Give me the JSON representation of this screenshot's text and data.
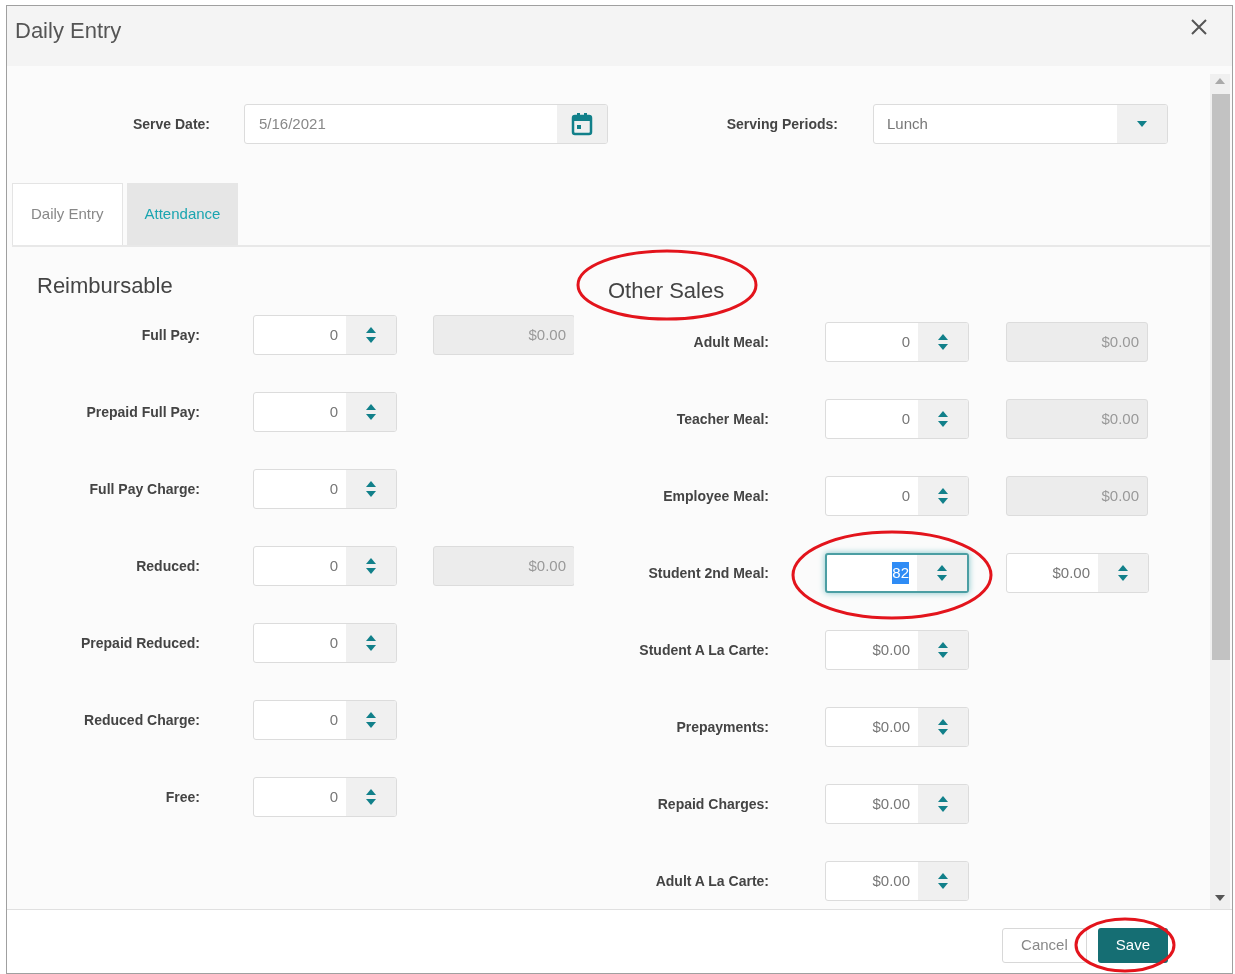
{
  "window": {
    "title": "Daily Entry"
  },
  "serve_date": {
    "label": "Serve Date:",
    "value": "5/16/2021"
  },
  "serving_periods": {
    "label": "Serving Periods:",
    "value": "Lunch"
  },
  "tabs": [
    {
      "label": "Daily Entry",
      "selected": true
    },
    {
      "label": "Attendance",
      "selected": false
    }
  ],
  "reimbursable": {
    "title": "Reimbursable",
    "rows": [
      {
        "label": "Full Pay:",
        "value": "0",
        "focused": false,
        "amount": {
          "kind": "readonly",
          "value": "$0.00"
        }
      },
      {
        "label": "Prepaid Full Pay:",
        "value": "0",
        "focused": false
      },
      {
        "label": "Full Pay Charge:",
        "value": "0",
        "focused": false
      },
      {
        "label": "Reduced:",
        "value": "0",
        "focused": false,
        "amount": {
          "kind": "readonly",
          "value": "$0.00"
        }
      },
      {
        "label": "Prepaid Reduced:",
        "value": "0",
        "focused": false
      },
      {
        "label": "Reduced Charge:",
        "value": "0",
        "focused": false
      },
      {
        "label": "Free:",
        "value": "0",
        "focused": false
      }
    ]
  },
  "other_sales": {
    "title": "Other Sales",
    "rows": [
      {
        "label": "Adult Meal:",
        "value": "0",
        "focused": false,
        "amount": {
          "kind": "readonly",
          "value": "$0.00"
        }
      },
      {
        "label": "Teacher Meal:",
        "value": "0",
        "focused": false,
        "amount": {
          "kind": "readonly",
          "value": "$0.00"
        }
      },
      {
        "label": "Employee Meal:",
        "value": "0",
        "focused": false,
        "amount": {
          "kind": "readonly",
          "value": "$0.00"
        }
      },
      {
        "label": "Student 2nd Meal:",
        "value": "82",
        "focused": true,
        "amount": {
          "kind": "spinner",
          "value": "$0.00"
        }
      },
      {
        "label": "Student A La Carte:",
        "value": "$0.00",
        "focused": false
      },
      {
        "label": "Prepayments:",
        "value": "$0.00",
        "focused": false
      },
      {
        "label": "Repaid Charges:",
        "value": "$0.00",
        "focused": false
      },
      {
        "label": "Adult A La Carte:",
        "value": "$0.00",
        "focused": false
      }
    ]
  },
  "footer": {
    "buttons": [
      {
        "label": "Cancel",
        "kind": "secondary"
      },
      {
        "label": "Save",
        "kind": "primary"
      }
    ]
  }
}
